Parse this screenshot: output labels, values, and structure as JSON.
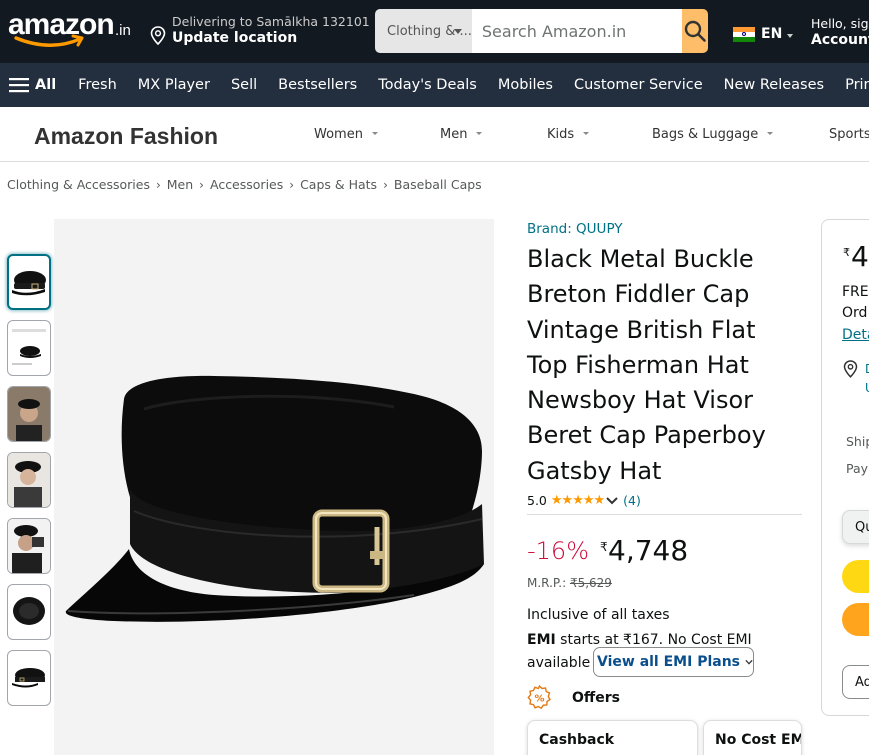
{
  "header": {
    "logo_text": "amazon",
    "logo_tld": ".in",
    "deliver_line1": "Delivering to Samālkha 132101",
    "deliver_line2": "Update location",
    "search_category": "Clothing & ...",
    "search_placeholder": "Search Amazon.in",
    "language": "EN",
    "account_line1": "Hello, sign",
    "account_line2": "Account"
  },
  "nav": {
    "all_label": "All",
    "items": [
      "Fresh",
      "MX Player",
      "Sell",
      "Bestsellers",
      "Today's Deals",
      "Mobiles",
      "Customer Service",
      "New Releases",
      "Prime"
    ]
  },
  "fashion": {
    "title": "Amazon Fashion",
    "categories": [
      "Women",
      "Men",
      "Kids",
      "Bags & Luggage",
      "Sports"
    ]
  },
  "breadcrumb": [
    "Clothing & Accessories",
    "Men",
    "Accessories",
    "Caps & Hats",
    "Baseball Caps"
  ],
  "product": {
    "brand": "Brand: QUUPY",
    "title": "Black Metal Buckle Breton Fiddler Cap Vintage British Flat Top Fisherman Hat Newsboy Hat Visor Beret Cap Paperboy Gatsby Hat",
    "rating": "5.0",
    "stars": "★★★★★",
    "review_count": "(4)",
    "discount": "-16%",
    "currency": "₹",
    "price": "4,748",
    "mrp_label": "M.R.P.: ",
    "mrp_value": "₹5,629",
    "taxes": "Inclusive of all taxes",
    "emi_bold": "EMI",
    "emi_text": " starts at ₹167. No Cost EMI available",
    "emi_button": "View all EMI Plans",
    "offers_label": "Offers",
    "offer_cards": [
      "Cashback",
      "No Cost EMI"
    ]
  },
  "buybox": {
    "currency": "₹",
    "price_partial": "4",
    "line_free": "FRE",
    "line_order": "Ord",
    "line_details": "Deta",
    "loc_line1": "D",
    "loc_line2": "U",
    "ships_label": "Ship",
    "pay_label": "Pay",
    "qty_label": "Qu",
    "add_label": "Ad"
  },
  "colors": {
    "header_bg": "#131921",
    "nav_bg": "#232f3e",
    "search_button": "#febd69",
    "link": "#007185",
    "discount": "#cc0c39",
    "star": "#ff9900",
    "add_to_cart": "#ffd814",
    "buy_now": "#ffa41c"
  }
}
